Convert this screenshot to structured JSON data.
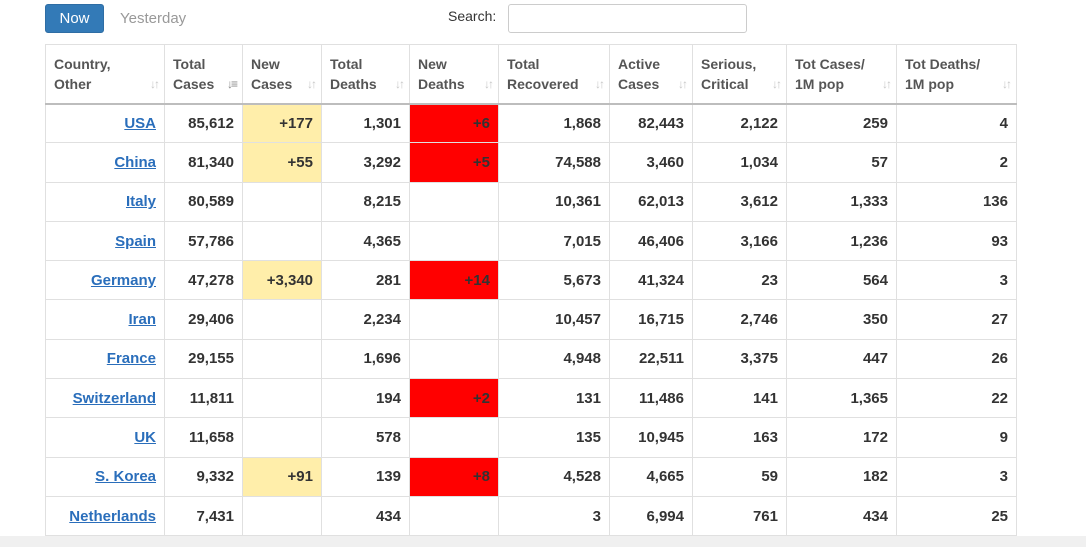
{
  "tabs": {
    "now": "Now",
    "yesterday": "Yesterday"
  },
  "search": {
    "label": "Search:",
    "value": "",
    "placeholder": ""
  },
  "colors": {
    "new_cases_highlight": "#ffeeaa",
    "new_deaths_highlight": "#ff0000",
    "link": "#2a6ebb",
    "active_tab": "#337ab7"
  },
  "table": {
    "headers": [
      [
        "Country,",
        "Other"
      ],
      [
        "Total",
        "Cases"
      ],
      [
        "New",
        "Cases"
      ],
      [
        "Total",
        "Deaths"
      ],
      [
        "New",
        "Deaths"
      ],
      [
        "Total",
        "Recovered"
      ],
      [
        "Active",
        "Cases"
      ],
      [
        "Serious,",
        "Critical"
      ],
      [
        "Tot Cases/",
        "1M pop"
      ],
      [
        "Tot Deaths/",
        "1M pop"
      ]
    ],
    "sorted_column": 1,
    "rows": [
      [
        "USA",
        "85,612",
        "+177",
        "1,301",
        "+6",
        "1,868",
        "82,443",
        "2,122",
        "259",
        "4"
      ],
      [
        "China",
        "81,340",
        "+55",
        "3,292",
        "+5",
        "74,588",
        "3,460",
        "1,034",
        "57",
        "2"
      ],
      [
        "Italy",
        "80,589",
        "",
        "8,215",
        "",
        "10,361",
        "62,013",
        "3,612",
        "1,333",
        "136"
      ],
      [
        "Spain",
        "57,786",
        "",
        "4,365",
        "",
        "7,015",
        "46,406",
        "3,166",
        "1,236",
        "93"
      ],
      [
        "Germany",
        "47,278",
        "+3,340",
        "281",
        "+14",
        "5,673",
        "41,324",
        "23",
        "564",
        "3"
      ],
      [
        "Iran",
        "29,406",
        "",
        "2,234",
        "",
        "10,457",
        "16,715",
        "2,746",
        "350",
        "27"
      ],
      [
        "France",
        "29,155",
        "",
        "1,696",
        "",
        "4,948",
        "22,511",
        "3,375",
        "447",
        "26"
      ],
      [
        "Switzerland",
        "11,811",
        "",
        "194",
        "+2",
        "131",
        "11,486",
        "141",
        "1,365",
        "22"
      ],
      [
        "UK",
        "11,658",
        "",
        "578",
        "",
        "135",
        "10,945",
        "163",
        "172",
        "9"
      ],
      [
        "S. Korea",
        "9,332",
        "+91",
        "139",
        "+8",
        "4,528",
        "4,665",
        "59",
        "182",
        "3"
      ],
      [
        "Netherlands",
        "7,431",
        "",
        "434",
        "",
        "3",
        "6,994",
        "761",
        "434",
        "25"
      ]
    ]
  }
}
